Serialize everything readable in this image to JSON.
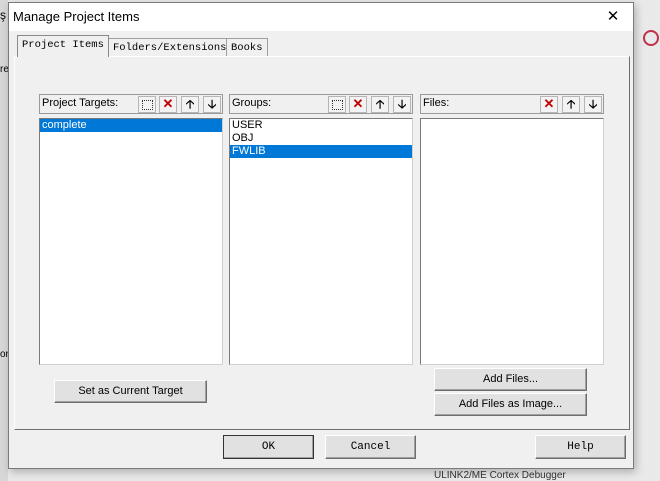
{
  "window": {
    "title": "Manage Project Items",
    "close_symbol": "✕"
  },
  "background": {
    "left_fragment_1": "ş",
    "left_fragment_2": "re",
    "left_fragment_3": "or",
    "bottom_right_text": "ULINK2/ME Cortex Debugger"
  },
  "tabs": [
    {
      "label": "Project Items"
    },
    {
      "label": "Folders/Extensions"
    },
    {
      "label": "Books"
    }
  ],
  "project_targets": {
    "label": "Project Targets:",
    "items": [
      {
        "text": "complete",
        "selected": true
      }
    ]
  },
  "groups": {
    "label": "Groups:",
    "items": [
      {
        "text": "USER",
        "selected": false
      },
      {
        "text": "OBJ",
        "selected": false
      },
      {
        "text": "FWLIB",
        "selected": true
      }
    ]
  },
  "files": {
    "label": "Files:",
    "items": []
  },
  "toolbar_icons": {
    "new": "",
    "delete": "✕",
    "up": "🡡",
    "down": "🡣"
  },
  "buttons": {
    "set_current_target": "Set as Current Target",
    "add_files": "Add Files...",
    "add_files_as_image": "Add Files as Image...",
    "ok": "OK",
    "cancel": "Cancel",
    "help": "Help"
  }
}
